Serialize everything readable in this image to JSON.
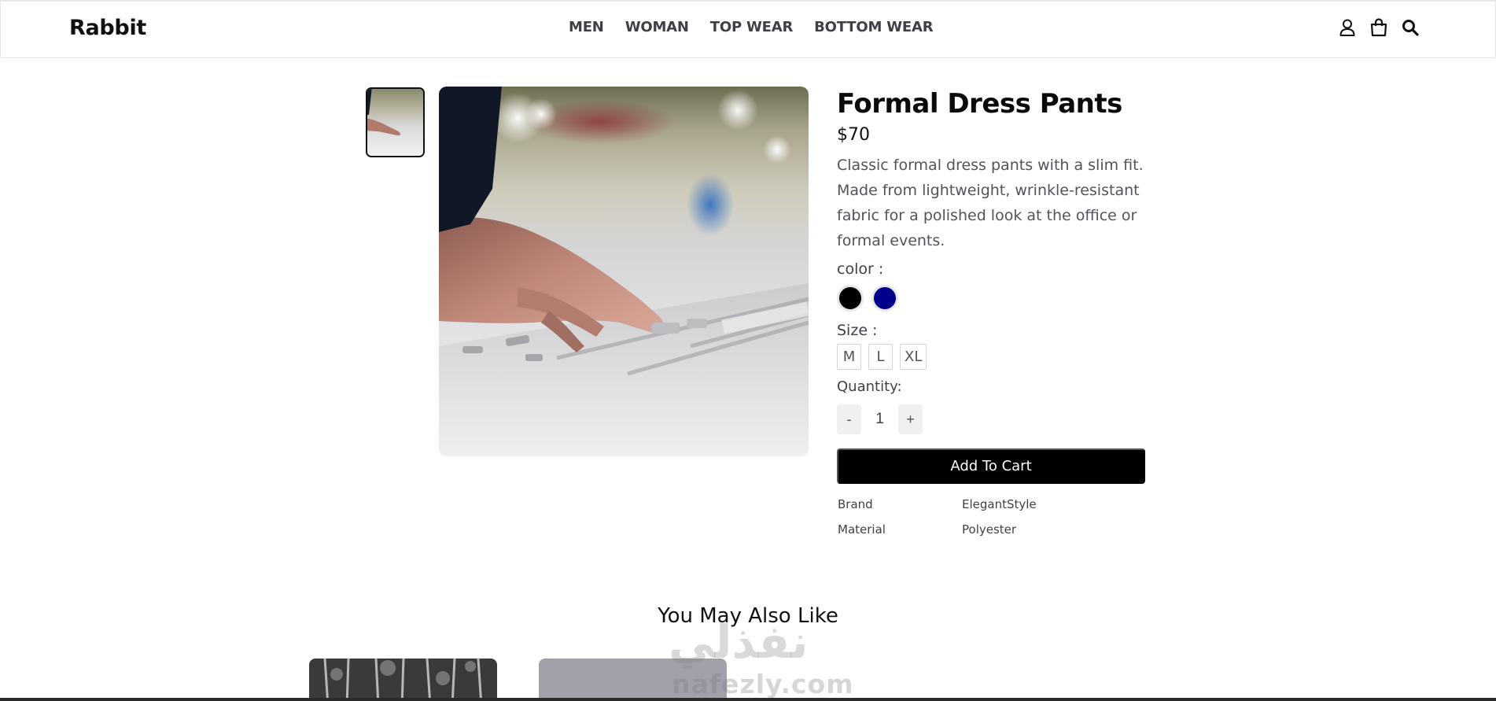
{
  "header": {
    "logo": "Rabbit",
    "nav": [
      "MEN",
      "WOMAN",
      "TOP WEAR",
      "BOTTOM WEAR"
    ],
    "icons": [
      "user-icon",
      "shopping-bag-icon",
      "search-icon"
    ]
  },
  "product": {
    "name": "Formal Dress Pants",
    "price": "$70",
    "description": "Classic formal dress pants with a slim fit. Made from lightweight, wrinkle-resistant fabric for a polished look at the office or formal events.",
    "color_label": "color :",
    "colors": [
      "#000000",
      "#00008b"
    ],
    "size_label": "Size :",
    "sizes": [
      "M",
      "L",
      "XL"
    ],
    "quantity_label": "Quantity:",
    "quantity_minus": "-",
    "quantity_value": "1",
    "quantity_plus": "+",
    "add_to_cart": "Add To Cart",
    "specs": [
      {
        "key": "Brand",
        "value": "ElegantStyle"
      },
      {
        "key": "Material",
        "value": "Polyester"
      }
    ]
  },
  "related": {
    "title": "You May Also Like"
  },
  "watermark": {
    "arabic": "نفذلي",
    "latin": "nafezly.com"
  }
}
